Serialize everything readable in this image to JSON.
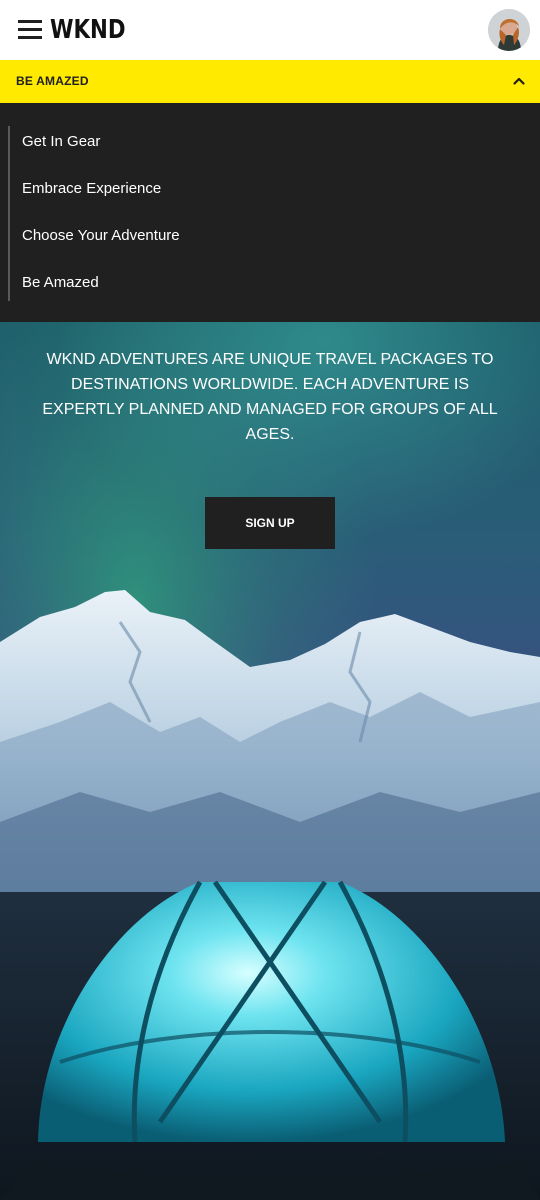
{
  "header": {
    "logo": "WKND",
    "menu_icon": "hamburger-icon",
    "avatar_icon": "user-avatar"
  },
  "nav": {
    "current_label": "BE AMAZED",
    "toggle_icon": "chevron-up-icon",
    "accent_color": "#ffea00"
  },
  "menu": {
    "items": [
      {
        "label": "Get In Gear"
      },
      {
        "label": "Embrace Experience"
      },
      {
        "label": "Choose Your Adventure"
      },
      {
        "label": "Be Amazed"
      }
    ]
  },
  "hero": {
    "text": "WKND Adventures are unique travel packages to destinations worldwide. Each adventure is expertly planned and managed for groups of all ages.",
    "cta_label": "SIGN UP"
  }
}
